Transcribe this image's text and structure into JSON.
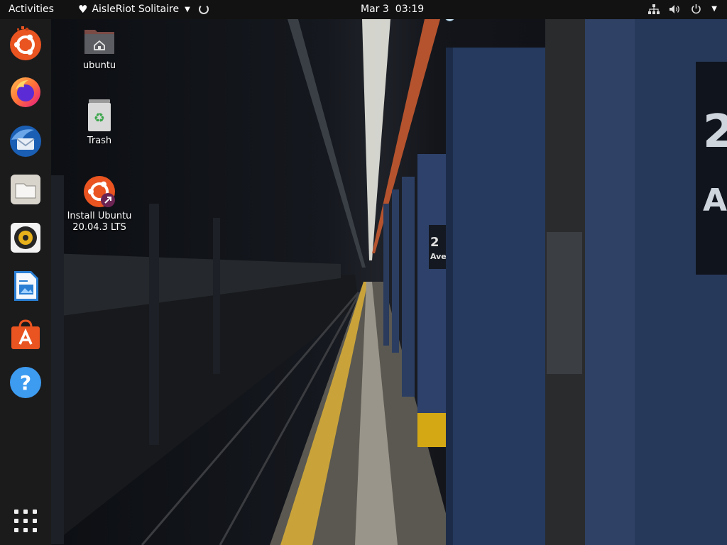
{
  "topbar": {
    "activities": "Activities",
    "app_name": "AisleRiot Solitaire",
    "date": "Mar 3",
    "time": "03:19"
  },
  "dock": {
    "items": [
      {
        "name": "Install Ubuntu",
        "icon": "ubuntu-installer-icon"
      },
      {
        "name": "Firefox",
        "icon": "firefox-icon"
      },
      {
        "name": "Thunderbird",
        "icon": "thunderbird-icon"
      },
      {
        "name": "Files",
        "icon": "files-icon"
      },
      {
        "name": "Rhythmbox",
        "icon": "rhythmbox-icon"
      },
      {
        "name": "LibreOffice Writer",
        "icon": "writer-icon"
      },
      {
        "name": "Ubuntu Software",
        "icon": "software-icon"
      },
      {
        "name": "Help",
        "icon": "help-icon"
      }
    ],
    "show_apps": "apps-grid-icon"
  },
  "desktop": {
    "home_label": "ubuntu",
    "trash_label": "Trash",
    "install_label_line1": "Install Ubuntu",
    "install_label_line2": "20.04.3 LTS"
  },
  "colors": {
    "topbar_bg": "#121212",
    "dock_bg": "#1e1e1e",
    "ubuntu_orange": "#e95420",
    "pillar_blue": "#253a5e"
  }
}
